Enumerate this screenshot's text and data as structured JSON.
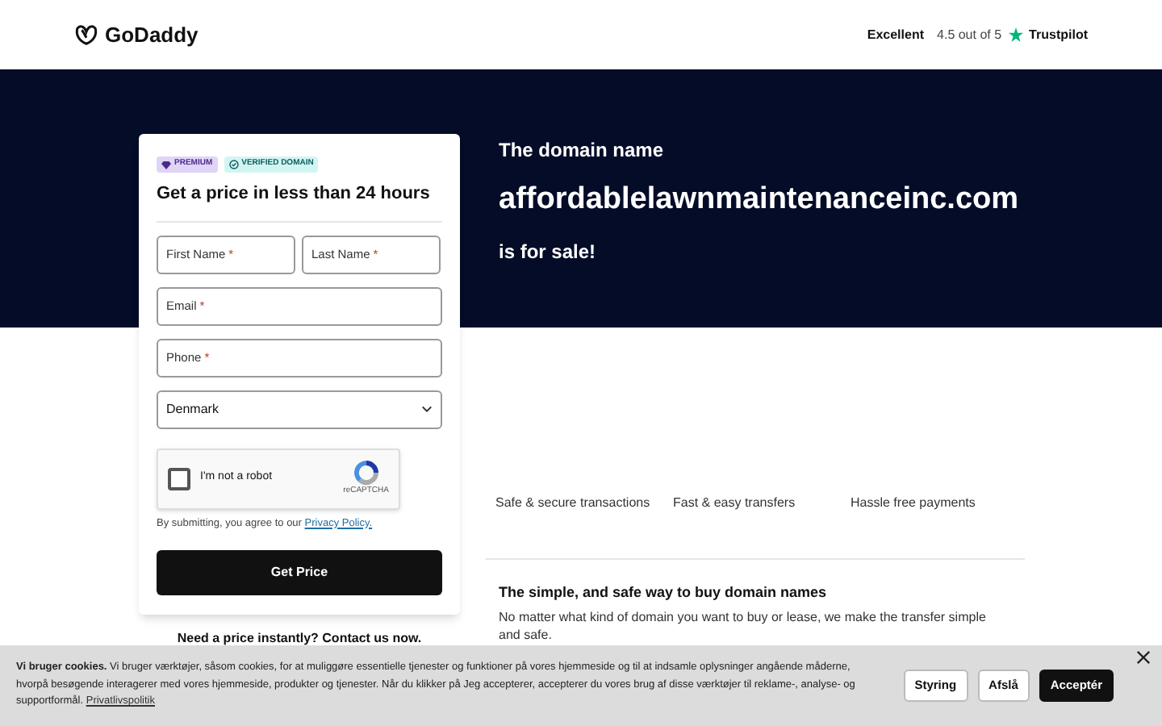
{
  "header": {
    "logo": "GoDaddy",
    "rating_label": "Excellent",
    "rating": "4.5 out of 5",
    "review_site": "Trustpilot"
  },
  "hero": {
    "intro": "The domain name",
    "domain": "affordablelawnmaintenanceinc.com",
    "outro": "is for sale!"
  },
  "form": {
    "badges": [
      {
        "label": "PREMIUM",
        "kind": "premium"
      },
      {
        "label": "VERIFIED DOMAIN",
        "kind": "verified"
      }
    ],
    "title": "Get a price in less than 24 hours",
    "fields": [
      {
        "label": "First Name",
        "required_mark": "*",
        "kind": "half"
      },
      {
        "label": "Last Name",
        "required_mark": "*",
        "kind": "half"
      },
      {
        "label": "Email",
        "required_mark": "*",
        "kind": "full"
      },
      {
        "label": "Phone",
        "required_mark": "*",
        "kind": "full"
      }
    ],
    "country": "Denmark",
    "captcha": {
      "label": "I'm not a robot",
      "brand": "reCAPTCHA",
      "checked": false
    },
    "consent": "By submitting, you agree to our",
    "consent_link": "Privacy Policy.",
    "submit": "Get Price"
  },
  "contact": "Need a price instantly? Contact us now.",
  "features": [
    "Safe & secure transactions",
    "Fast & easy transfers",
    "Hassle free payments"
  ],
  "info": {
    "title": "The simple, and safe way to buy domain names",
    "body": "No matter what kind of domain you want to buy or lease, we make the transfer simple and safe."
  },
  "cookie": {
    "lead": "Vi bruger cookies.",
    "text": "Vi bruger værktøjer, såsom cookies, for at muliggøre essentielle tjenester og funktioner på vores hjemmeside og til at indsamle oplysninger angående måderne, hvorpå besøgende interagerer med vores hjemmeside, produkter og tjenester. Når du klikker på Jeg accepterer, accepterer du vores brug af disse værktøjer til reklame-, analyse- og supportformål.",
    "link": "Privatlivspolitik",
    "buttons": [
      {
        "label": "Styring",
        "kind": "secondary"
      },
      {
        "label": "Afslå",
        "kind": "secondary"
      },
      {
        "label": "Acceptér",
        "kind": "primary"
      }
    ]
  }
}
